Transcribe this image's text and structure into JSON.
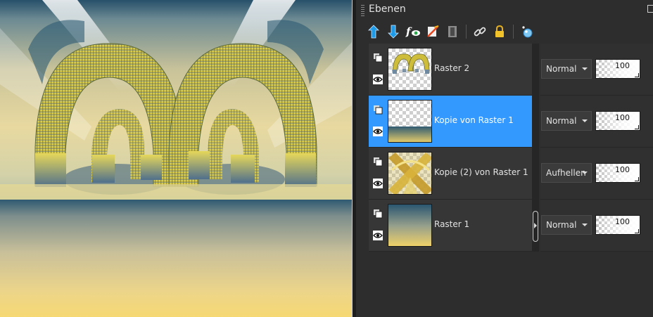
{
  "panel": {
    "title": "Ebenen"
  },
  "toolbar": {
    "buttons": [
      "new-raster-layer-icon",
      "new-vector-layer-icon",
      "layer-effects-icon",
      "delete-layer-icon",
      "mask-icon",
      "link-layers-icon",
      "lock-icon",
      "layer-properties-icon"
    ]
  },
  "layers": [
    {
      "name": "Raster 2",
      "blend_mode": "Normal",
      "opacity": "100",
      "selected": false,
      "thumbnail": "arches"
    },
    {
      "name": "Kopie von Raster 1",
      "blend_mode": "Normal",
      "opacity": "100",
      "selected": true,
      "thumbnail": "gradient-bottom"
    },
    {
      "name": "Kopie (2) von Raster 1",
      "blend_mode": "Aufhellen",
      "opacity": "100",
      "selected": false,
      "thumbnail": "golden-cross"
    },
    {
      "name": "Raster 1",
      "blend_mode": "Normal",
      "opacity": "100",
      "selected": false,
      "thumbnail": "gradient-full"
    }
  ],
  "colors": {
    "selection": "#3399ff",
    "panel_bg": "#2d2d2d",
    "accent_blue": "#1e9be8",
    "arch_yellow": "#d8cc4a"
  }
}
